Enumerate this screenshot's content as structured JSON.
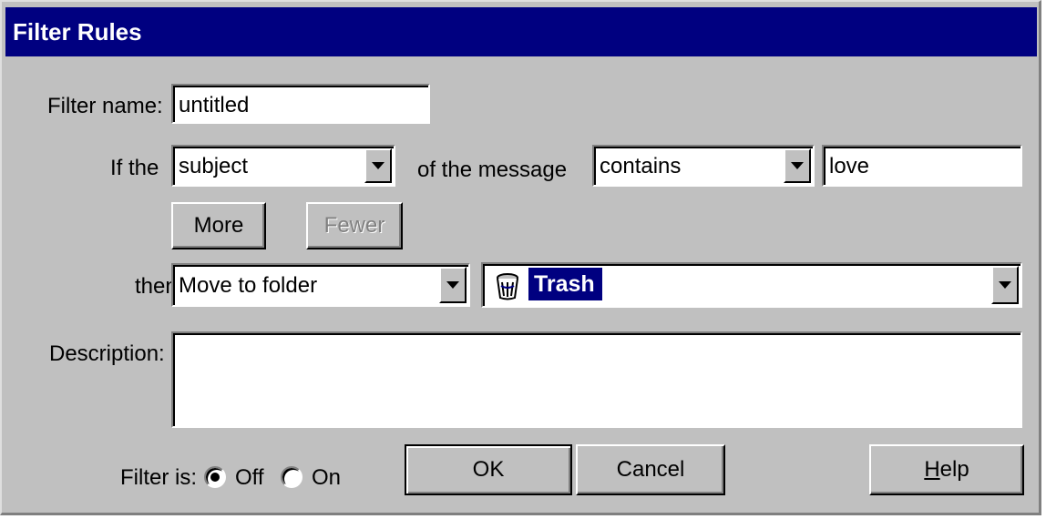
{
  "window": {
    "title": "Filter Rules"
  },
  "labels": {
    "filter_name": "Filter name:",
    "if_the": "If the",
    "of_the_message": "of the message",
    "then": "then",
    "description": "Description:",
    "filter_is": "Filter is:",
    "off": "Off",
    "on": "On"
  },
  "fields": {
    "filter_name_value": "untitled",
    "field_select_value": "subject",
    "operator_select_value": "contains",
    "criteria_value": "love",
    "action_select_value": "Move to folder",
    "folder_select_value": "Trash",
    "description_value": ""
  },
  "buttons": {
    "more": "More",
    "fewer": "Fewer",
    "ok": "OK",
    "cancel": "Cancel",
    "help_prefix": "H",
    "help_rest": "elp"
  },
  "state": {
    "filter_on": false,
    "fewer_enabled": false
  },
  "icons": {
    "dropdown": "chevron-down-icon",
    "folder": "trash-can-icon",
    "radio": "radio-icon"
  },
  "colors": {
    "titlebar": "#000080",
    "face": "#c0c0c0",
    "selection": "#000080"
  }
}
